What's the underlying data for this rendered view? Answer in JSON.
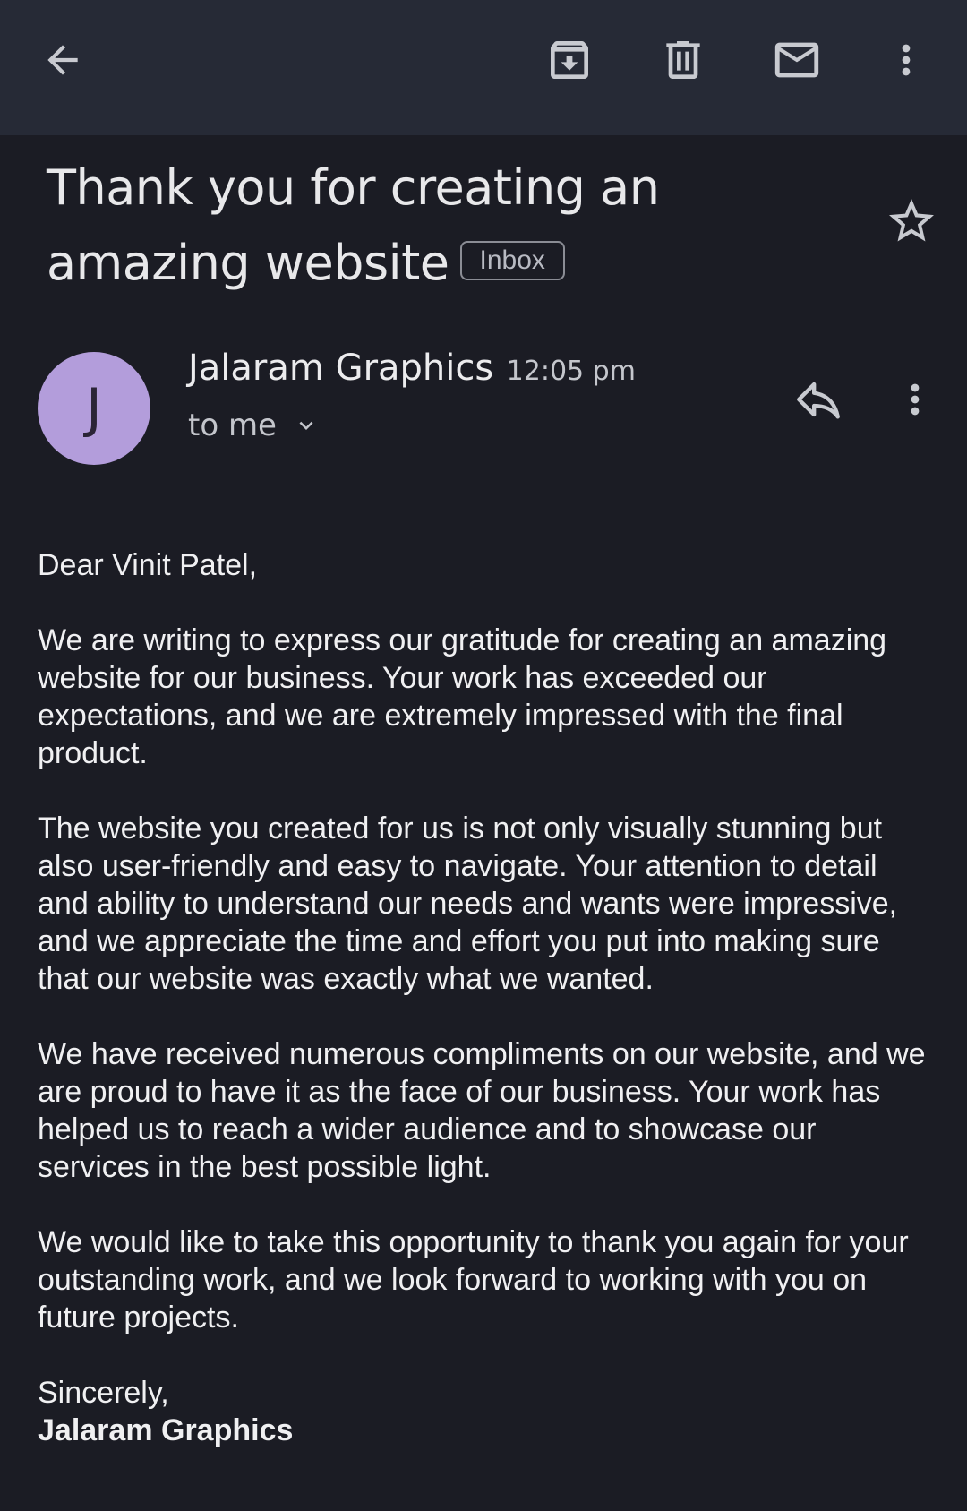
{
  "toolbar": {
    "icons": [
      "back-arrow-icon",
      "archive-icon",
      "delete-icon",
      "mark-unread-icon",
      "more-vert-icon"
    ]
  },
  "email": {
    "subject": "Thank you for creating an amazing website",
    "label": "Inbox",
    "starred": false,
    "sender": {
      "initial": "J",
      "name": "Jalaram Graphics",
      "time": "12:05 pm",
      "recipient": "to me",
      "avatar_color": "#b39ddb"
    },
    "body": {
      "greeting": "Dear Vinit Patel,",
      "paragraphs": [
        "We are writing to express our gratitude for creating an amazing website for our business. Your work has exceeded our expectations, and we are extremely impressed with the final product.",
        "The website you created for us is not only visually stunning but also user-friendly and easy to navigate. Your attention to detail and ability to understand our needs and wants were impressive, and we appreciate the time and effort you put into making sure that our website was exactly what we wanted.",
        "We have received numerous compliments on our website, and we are proud to have it as the face of our business. Your work has helped us to reach a wider audience and to showcase our services in the best possible light.",
        "We would like to take this opportunity to thank you again for your outstanding work, and we look forward to working with you on future projects."
      ],
      "closing": "Sincerely,",
      "signature": "Jalaram Graphics"
    }
  },
  "colors": {
    "background": "#1b1c24",
    "toolbar": "#262a36",
    "text": "#e6e6e8"
  }
}
